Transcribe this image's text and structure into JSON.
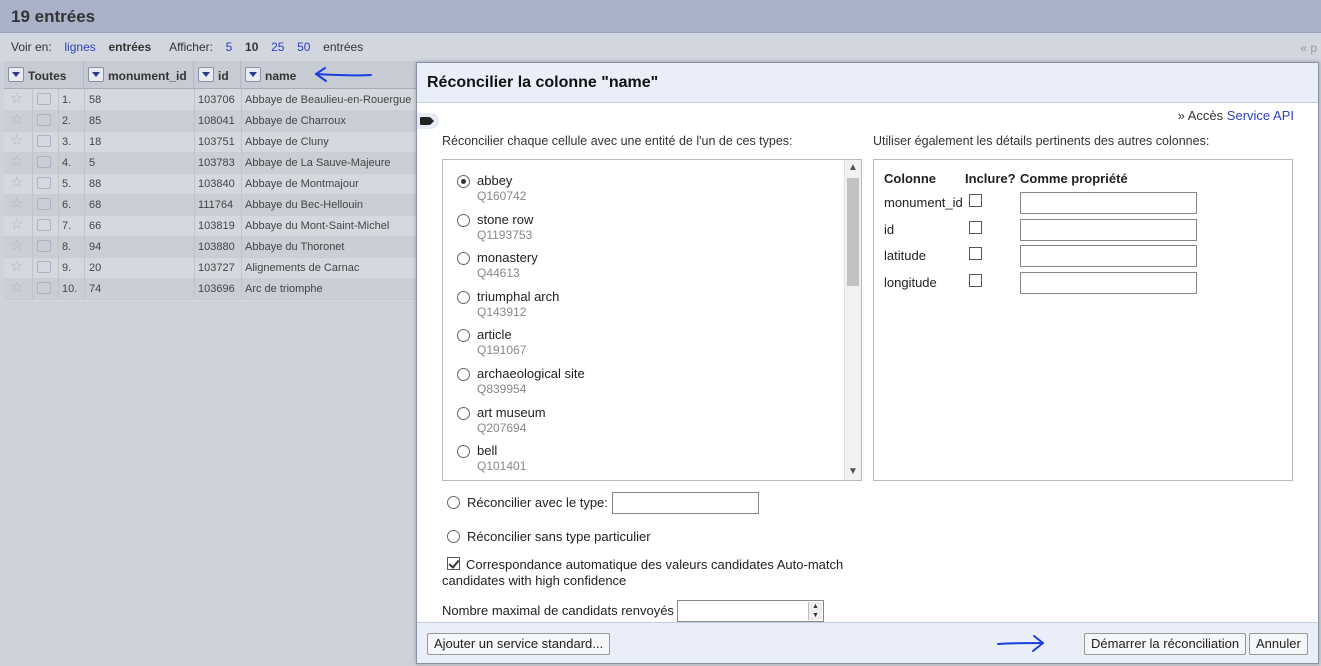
{
  "app": {
    "rows_count_title": "19 entrées",
    "view": {
      "voir_en": "Voir en:",
      "lignes": "lignes",
      "entrees": "entrées",
      "afficher": "Afficher:",
      "opt5": "5",
      "opt10": "10",
      "opt25": "25",
      "opt50": "50",
      "entrees2": "entrées",
      "pager_prev": "« p"
    },
    "columns": [
      "Toutes",
      "monument_id",
      "id",
      "name"
    ],
    "rows": [
      {
        "n": "1.",
        "monument_id": "58",
        "id": "103706",
        "name": "Abbaye de Beaulieu-en-Rouergue"
      },
      {
        "n": "2.",
        "monument_id": "85",
        "id": "108041",
        "name": "Abbaye de Charroux"
      },
      {
        "n": "3.",
        "monument_id": "18",
        "id": "103751",
        "name": "Abbaye de Cluny"
      },
      {
        "n": "4.",
        "monument_id": "5",
        "id": "103783",
        "name": "Abbaye de La Sauve-Majeure"
      },
      {
        "n": "5.",
        "monument_id": "88",
        "id": "103840",
        "name": "Abbaye de Montmajour"
      },
      {
        "n": "6.",
        "monument_id": "68",
        "id": "111764",
        "name": "Abbaye du Bec-Hellouin"
      },
      {
        "n": "7.",
        "monument_id": "66",
        "id": "103819",
        "name": "Abbaye du Mont-Saint-Michel"
      },
      {
        "n": "8.",
        "monument_id": "94",
        "id": "103880",
        "name": "Abbaye du Thoronet"
      },
      {
        "n": "9.",
        "monument_id": "20",
        "id": "103727",
        "name": "Alignements de Carnac"
      },
      {
        "n": "10.",
        "monument_id": "74",
        "id": "103696",
        "name": "Arc de triomphe"
      }
    ]
  },
  "dialog": {
    "title": "Réconcilier la colonne \"name\"",
    "service_prefix": "» Accès",
    "service_link": "Service API",
    "types_label": "Réconcilier chaque cellule avec une entité de l'un de ces types:",
    "types": [
      {
        "name": "abbey",
        "qid": "Q160742",
        "selected": true
      },
      {
        "name": "stone row",
        "qid": "Q1193753",
        "selected": false
      },
      {
        "name": "monastery",
        "qid": "Q44613",
        "selected": false
      },
      {
        "name": "triumphal arch",
        "qid": "Q143912",
        "selected": false
      },
      {
        "name": "article",
        "qid": "Q191067",
        "selected": false
      },
      {
        "name": "archaeological site",
        "qid": "Q839954",
        "selected": false
      },
      {
        "name": "art museum",
        "qid": "Q207694",
        "selected": false
      },
      {
        "name": "bell",
        "qid": "Q101401",
        "selected": false
      }
    ],
    "other_cols_label": "Utiliser également les détails pertinents des autres colonnes:",
    "cols_header": {
      "colonne": "Colonne",
      "inclure": "Inclure?",
      "propriete": "Comme propriété"
    },
    "other_cols": [
      {
        "name": "monument_id",
        "include": false,
        "property": ""
      },
      {
        "name": "id",
        "include": false,
        "property": ""
      },
      {
        "name": "latitude",
        "include": false,
        "property": ""
      },
      {
        "name": "longitude",
        "include": false,
        "property": ""
      }
    ],
    "reconcile_with_type": "Réconcilier avec le type:",
    "reconcile_with_type_value": "",
    "reconcile_no_type": "Réconcilier sans type particulier",
    "automatch_label": "Correspondance automatique des valeurs candidates Auto-match candidates with high confidence",
    "automatch_checked": true,
    "max_candidates_label": "Nombre maximal de candidats renvoyés",
    "max_candidates_value": "",
    "add_service_button": "Ajouter un service standard...",
    "start_button": "Démarrer la réconciliation",
    "cancel_button": "Annuler"
  },
  "colors": {
    "link": "#2c3fbf",
    "annotation_arrow": "#1a3fe0",
    "dialog_header_bg": "#e9eef8"
  }
}
